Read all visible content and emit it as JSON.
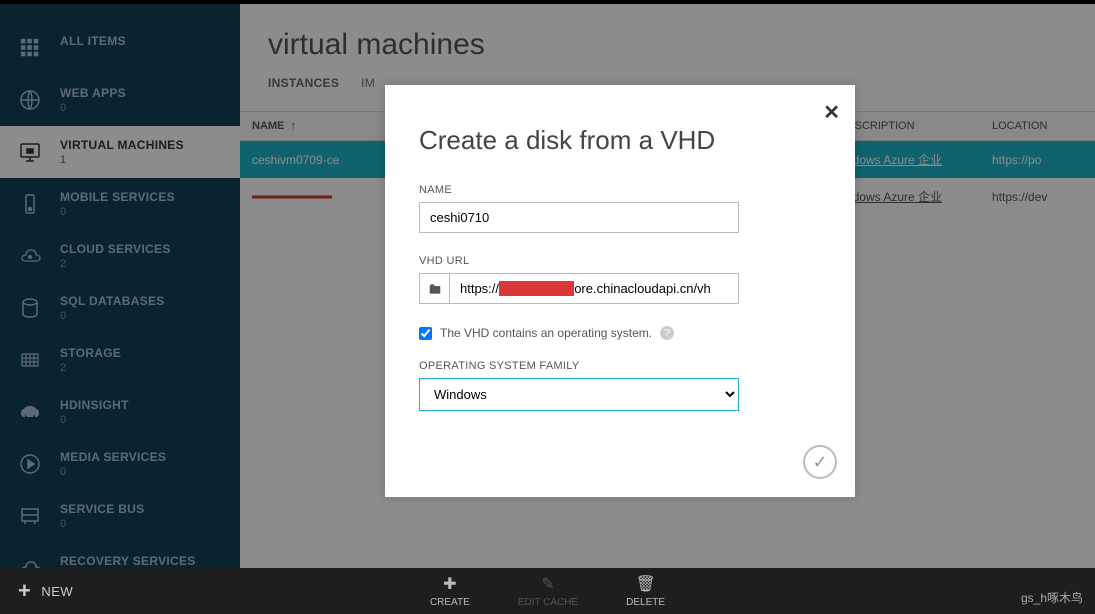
{
  "sidebar": {
    "items": [
      {
        "label": "ALL ITEMS",
        "count": ""
      },
      {
        "label": "WEB APPS",
        "count": "0"
      },
      {
        "label": "VIRTUAL MACHINES",
        "count": "1"
      },
      {
        "label": "MOBILE SERVICES",
        "count": "0"
      },
      {
        "label": "CLOUD SERVICES",
        "count": "2"
      },
      {
        "label": "SQL DATABASES",
        "count": "0"
      },
      {
        "label": "STORAGE",
        "count": "2"
      },
      {
        "label": "HDINSIGHT",
        "count": "0"
      },
      {
        "label": "MEDIA SERVICES",
        "count": "0"
      },
      {
        "label": "SERVICE BUS",
        "count": "0"
      },
      {
        "label": "RECOVERY SERVICES",
        "count": ""
      }
    ]
  },
  "page": {
    "title": "virtual machines",
    "tabs": [
      "INSTANCES",
      "IM"
    ]
  },
  "table": {
    "headers": {
      "name": "NAME",
      "sub": "SUBSCRIPTION",
      "loc": "LOCATION"
    },
    "rows": [
      {
        "name": "ceshivm0709-ce",
        "sub": "Windows Azure 企业",
        "loc": "https://po"
      },
      {
        "name": "redacted-01",
        "sub": "Windows Azure 企业",
        "loc": "https://dev"
      }
    ]
  },
  "modal": {
    "title": "Create a disk from a VHD",
    "name_label": "NAME",
    "name_value": "ceshi0710",
    "vhd_label": "VHD URL",
    "vhd_value_prefix": "https://",
    "vhd_redacted": "redactedblob",
    "vhd_value_suffix": "ore.chinacloudapi.cn/vh",
    "os_checkbox": "The VHD contains an operating system.",
    "os_family_label": "OPERATING SYSTEM FAMILY",
    "os_family_value": "Windows"
  },
  "bottombar": {
    "new": "NEW",
    "actions": [
      {
        "label": "CREATE"
      },
      {
        "label": "EDIT CACHE"
      },
      {
        "label": "DELETE"
      }
    ]
  },
  "watermark": "gs_h啄木鸟"
}
